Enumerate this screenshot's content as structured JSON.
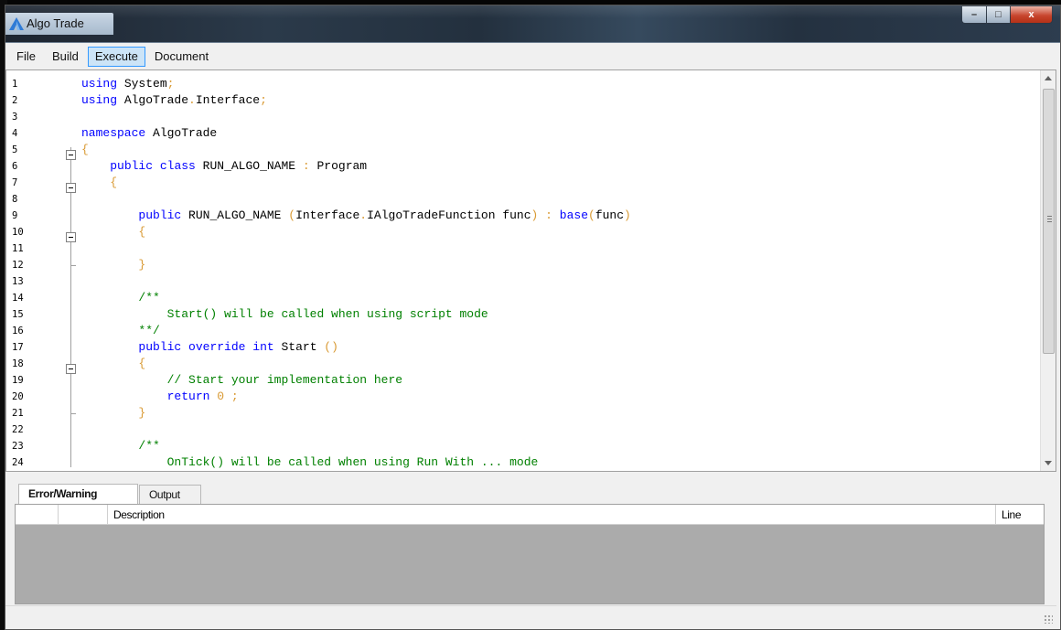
{
  "window": {
    "title": "Algo Trade",
    "controls": {
      "minimize": "–",
      "maximize": "□",
      "close": "x"
    }
  },
  "menu": [
    {
      "label": "File",
      "active": false
    },
    {
      "label": "Build",
      "active": false
    },
    {
      "label": "Execute",
      "active": true
    },
    {
      "label": "Document",
      "active": false
    }
  ],
  "editor": {
    "line_numbers": [
      "1",
      "2",
      "3",
      "4",
      "5",
      "6",
      "7",
      "8",
      "9",
      "10",
      "11",
      "12",
      "13",
      "14",
      "15",
      "16",
      "17",
      "18",
      "19",
      "20",
      "21",
      "22",
      "23",
      "24"
    ],
    "lines": [
      [
        [
          "kw",
          "using"
        ],
        [
          "id",
          " System"
        ],
        [
          "pn",
          ";"
        ]
      ],
      [
        [
          "kw",
          "using"
        ],
        [
          "id",
          " AlgoTrade"
        ],
        [
          "pn",
          "."
        ],
        [
          "id",
          "Interface"
        ],
        [
          "pn",
          ";"
        ]
      ],
      [],
      [
        [
          "kw",
          "namespace"
        ],
        [
          "id",
          " AlgoTrade"
        ]
      ],
      [
        [
          "pn",
          "{"
        ]
      ],
      [
        [
          "id",
          "    "
        ],
        [
          "kw",
          "public"
        ],
        [
          "id",
          " "
        ],
        [
          "kw",
          "class"
        ],
        [
          "id",
          " RUN_ALGO_NAME "
        ],
        [
          "pn",
          ":"
        ],
        [
          "id",
          " Program"
        ]
      ],
      [
        [
          "id",
          "    "
        ],
        [
          "pn",
          "{"
        ]
      ],
      [],
      [
        [
          "id",
          "        "
        ],
        [
          "kw",
          "public"
        ],
        [
          "id",
          " RUN_ALGO_NAME "
        ],
        [
          "pn",
          "("
        ],
        [
          "id",
          "Interface"
        ],
        [
          "pn",
          "."
        ],
        [
          "id",
          "IAlgoTradeFunction func"
        ],
        [
          "pn",
          ")"
        ],
        [
          "id",
          " "
        ],
        [
          "pn",
          ":"
        ],
        [
          "id",
          " "
        ],
        [
          "kw",
          "base"
        ],
        [
          "pn",
          "("
        ],
        [
          "id",
          "func"
        ],
        [
          "pn",
          ")"
        ]
      ],
      [
        [
          "id",
          "        "
        ],
        [
          "pn",
          "{"
        ]
      ],
      [],
      [
        [
          "id",
          "        "
        ],
        [
          "pn",
          "}"
        ]
      ],
      [],
      [
        [
          "id",
          "        "
        ],
        [
          "cm",
          "/**"
        ]
      ],
      [
        [
          "id",
          "            "
        ],
        [
          "cm",
          "Start() will be called when using script mode"
        ]
      ],
      [
        [
          "id",
          "        "
        ],
        [
          "cm",
          "**/"
        ]
      ],
      [
        [
          "id",
          "        "
        ],
        [
          "kw",
          "public"
        ],
        [
          "id",
          " "
        ],
        [
          "kw",
          "override"
        ],
        [
          "id",
          " "
        ],
        [
          "kw",
          "int"
        ],
        [
          "id",
          " Start "
        ],
        [
          "pn",
          "()"
        ]
      ],
      [
        [
          "id",
          "        "
        ],
        [
          "pn",
          "{"
        ]
      ],
      [
        [
          "id",
          "            "
        ],
        [
          "cm",
          "// Start your implementation here"
        ]
      ],
      [
        [
          "id",
          "            "
        ],
        [
          "kw",
          "return"
        ],
        [
          "id",
          " "
        ],
        [
          "num",
          "0"
        ],
        [
          "id",
          " "
        ],
        [
          "pn",
          ";"
        ]
      ],
      [
        [
          "id",
          "        "
        ],
        [
          "pn",
          "}"
        ]
      ],
      [],
      [
        [
          "id",
          "        "
        ],
        [
          "cm",
          "/**"
        ]
      ],
      [
        [
          "id",
          "            "
        ],
        [
          "cm",
          "OnTick() will be called when using Run With ... mode"
        ]
      ]
    ]
  },
  "panel": {
    "tabs": [
      {
        "label": "Error/Warning",
        "active": true
      },
      {
        "label": "Output",
        "active": false
      }
    ],
    "columns": {
      "description": "Description",
      "line": "Line"
    }
  },
  "colors": {
    "keyword": "#0000ff",
    "comment": "#008000",
    "punct": "#d99a34",
    "menu_active": "#cce4f7"
  }
}
